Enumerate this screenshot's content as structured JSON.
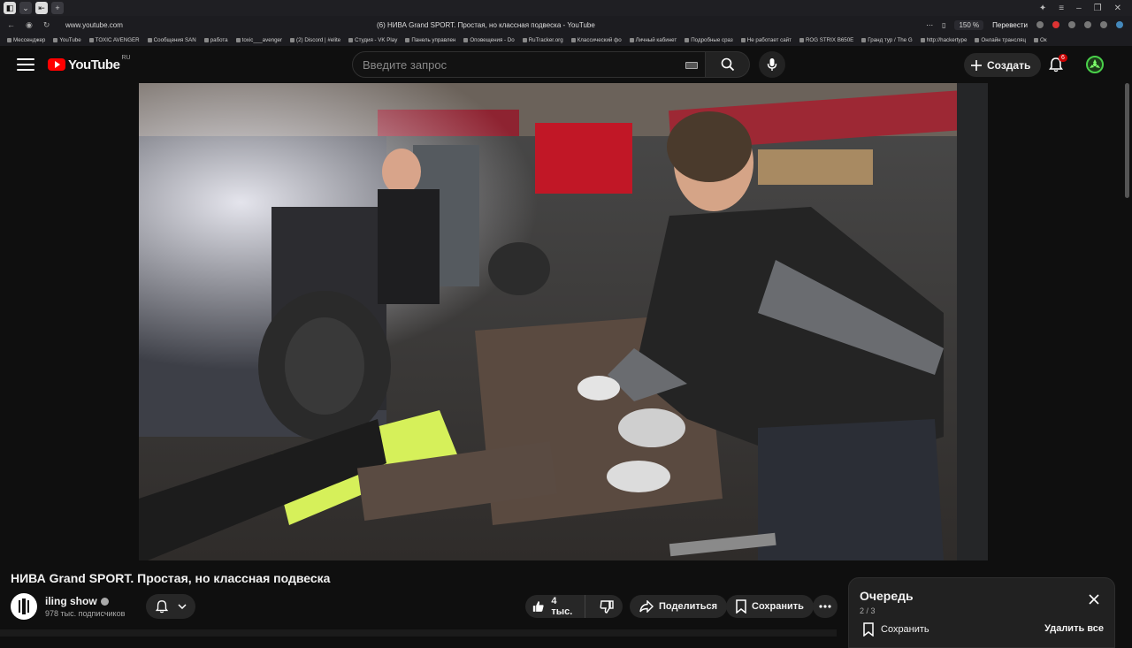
{
  "browser": {
    "url": "www.youtube.com",
    "tab_title": "(6) НИВА Grand SPORT. Простая, но классная подвеска - YouTube",
    "zoom": "150 %",
    "translate_label": "Перевести",
    "bookmarks": [
      "Мессенджер",
      "YouTube",
      "TOXIC AVENGER",
      "Сообщения SAN",
      "работа",
      "toxic___avenger",
      "(2) Discord | #elite",
      "Студия - VK Play",
      "Панель управлен",
      "Оповещения - Do",
      "RuTracker.org",
      "Классический фо",
      "Личный кабинет",
      "Подробные сраз",
      "Не работает сайт",
      "ROG STRIX B650E",
      "Гранд тур / The G",
      "http://hackertype",
      "Онлайн трансляц",
      "Ок"
    ]
  },
  "header": {
    "logo_text": "YouTube",
    "region": "RU",
    "search_placeholder": "Введите запрос",
    "create_label": "Создать",
    "notifications_count": "6",
    "accent": "#ff0000"
  },
  "video": {
    "title": "НИВА Grand SPORT. Простая, но классная подвеска",
    "channel_name": "iling show",
    "subscribers": "978 тыс. подписчиков",
    "likes": "4 тыс.",
    "share_label": "Поделиться",
    "save_label": "Сохранить"
  },
  "queue": {
    "title": "Очередь",
    "position": "2 / 3",
    "save_label": "Сохранить",
    "delete_all_label": "Удалить все"
  }
}
